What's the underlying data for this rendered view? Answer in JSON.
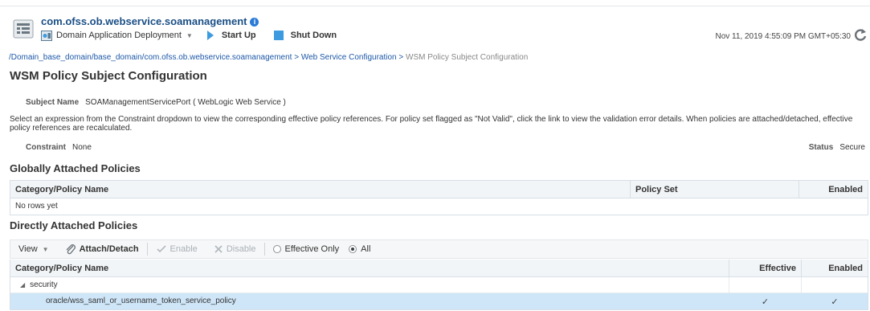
{
  "header": {
    "app_title": "com.ofss.ob.webservice.soamanagement",
    "menu_label": "Domain Application Deployment",
    "start_up": "Start Up",
    "shut_down": "Shut Down",
    "timestamp": "Nov 11, 2019 4:55:09 PM GMT+05:30",
    "accent_color": "#3c9ae0"
  },
  "breadcrumb": {
    "link1": "/Domain_base_domain/base_domain/com.ofss.ob.webservice.soamanagement",
    "sep1": " > ",
    "link2": "Web Service Configuration",
    "sep2": " > ",
    "current": "WSM Policy Subject Configuration"
  },
  "page_title": "WSM Policy Subject Configuration",
  "subject": {
    "label": "Subject Name",
    "value": "SOAManagementServicePort ( WebLogic Web Service )"
  },
  "description": "Select an expression from the Constraint dropdown to view the corresponding effective policy references. For policy set flagged as \"Not Valid\", click the link to view the validation error details. When policies are attached/detached, effective policy references are recalculated.",
  "constraint": {
    "label": "Constraint",
    "value": "None"
  },
  "status": {
    "label": "Status",
    "value": "Secure"
  },
  "global_section": {
    "title": "Globally Attached Policies",
    "columns": [
      "Category/Policy Name",
      "Policy Set",
      "Enabled"
    ],
    "empty_text": "No rows yet"
  },
  "direct_section": {
    "title": "Directly Attached Policies",
    "toolbar": {
      "view": "View",
      "attach_detach": "Attach/Detach",
      "enable": "Enable",
      "disable": "Disable",
      "effective_only": "Effective Only",
      "all": "All"
    },
    "columns": [
      "Category/Policy Name",
      "Effective",
      "Enabled"
    ],
    "rows": [
      {
        "name": "security",
        "effective": "",
        "enabled": ""
      },
      {
        "name": "oracle/wss_saml_or_username_token_service_policy",
        "effective": "✓",
        "enabled": "✓"
      }
    ]
  }
}
